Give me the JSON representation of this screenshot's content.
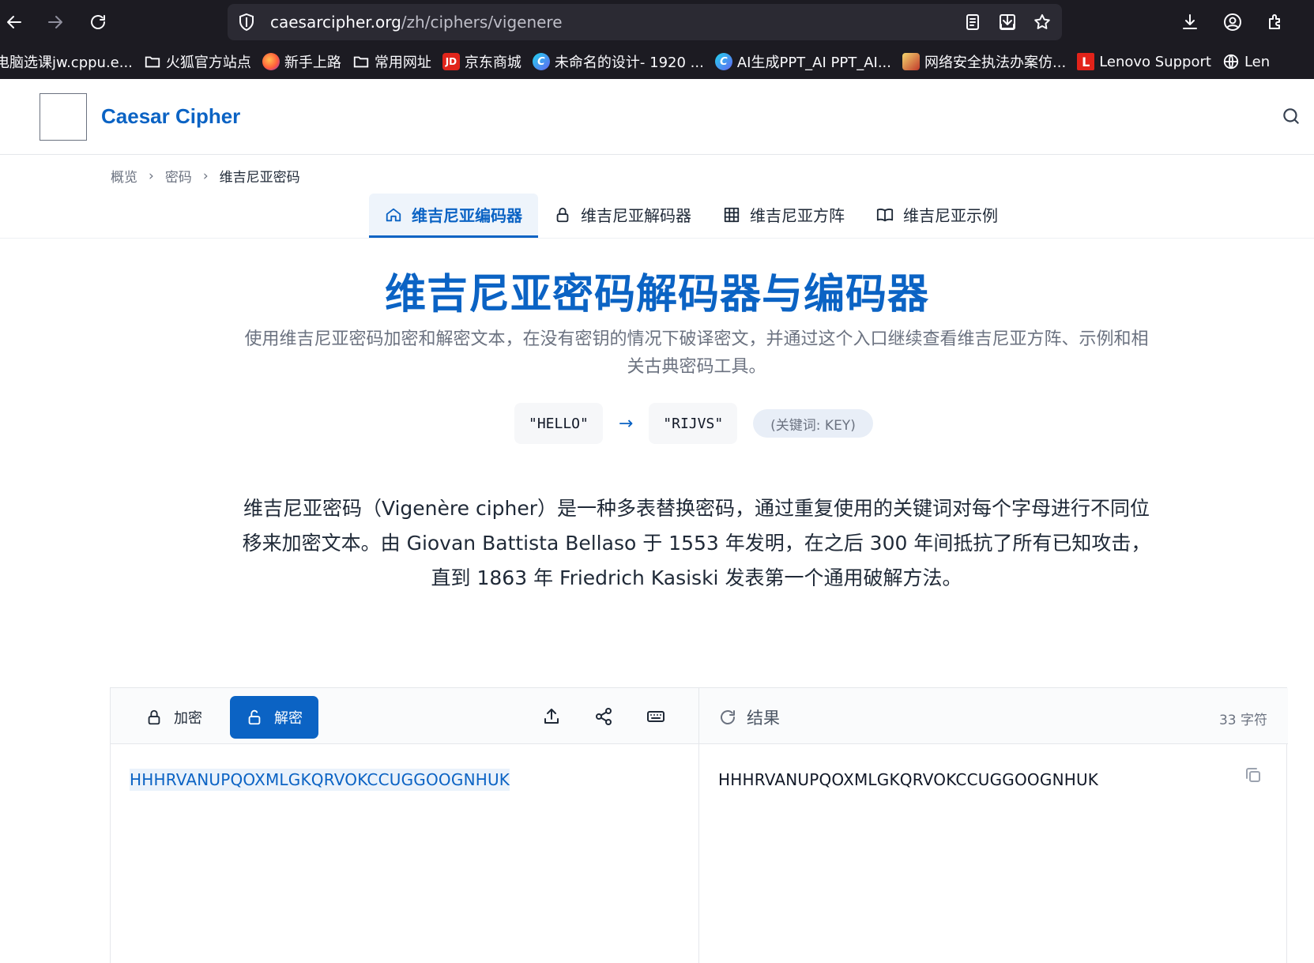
{
  "browser": {
    "url_host": "caesarcipher.org",
    "url_path": "/zh/ciphers/vigenere",
    "bookmarks": [
      {
        "label": "电脑选课jw.cppu.e...",
        "icon": "none"
      },
      {
        "label": "火狐官方站点",
        "icon": "folder-icon"
      },
      {
        "label": "新手上路",
        "icon": "firefox-icon"
      },
      {
        "label": "常用网址",
        "icon": "folder-icon"
      },
      {
        "label": "京东商城",
        "icon": "jd-icon",
        "icon_text": "JD",
        "color": "#e1251b"
      },
      {
        "label": "未命名的设计- 1920 ...",
        "icon": "canva-icon",
        "icon_text": "C",
        "color": "#3b82f6"
      },
      {
        "label": "AI生成PPT_AI PPT_AI...",
        "icon": "canva-icon",
        "icon_text": "C",
        "color": "#3b82f6"
      },
      {
        "label": "网络安全执法办案仿...",
        "icon": "image-icon",
        "icon_text": "",
        "color": "#d4a017"
      },
      {
        "label": "Lenovo Support",
        "icon": "lenovo-icon",
        "icon_text": "L",
        "color": "#e2231a"
      },
      {
        "label": "Len",
        "icon": "globe-icon"
      }
    ]
  },
  "header": {
    "brand": "Caesar Cipher"
  },
  "breadcrumb": {
    "items": [
      "概览",
      "密码",
      "维吉尼亚密码"
    ]
  },
  "tabs": [
    {
      "label": "维吉尼亚编码器",
      "icon": "home-icon",
      "active": true
    },
    {
      "label": "维吉尼亚解码器",
      "icon": "unlock-icon",
      "active": false
    },
    {
      "label": "维吉尼亚方阵",
      "icon": "grid-icon",
      "active": false
    },
    {
      "label": "维吉尼亚示例",
      "icon": "book-icon",
      "active": false
    }
  ],
  "hero": {
    "title": "维吉尼亚密码解码器与编码器",
    "subtitle": "使用维吉尼亚密码加密和解密文本，在没有密钥的情况下破译密文，并通过这个入口继续查看维吉尼亚方阵、示例和相关古典密码工具。"
  },
  "example": {
    "plain": "\"HELLO\"",
    "arrow": "→",
    "cipher": "\"RIJVS\"",
    "key_note": "(关键词: KEY)"
  },
  "description": "维吉尼亚密码（Vigenère cipher）是一种多表替换密码，通过重复使用的关键词对每个字母进行不同位移来加密文本。由 Giovan Battista Bellaso 于 1553 年发明，在之后 300 年间抵抗了所有已知攻击，直到 1863 年 Friedrich Kasiski 发表第一个通用破解方法。",
  "tool": {
    "encrypt_label": "加密",
    "decrypt_label": "解密",
    "active_mode": "decrypt",
    "input_value": "HHHRVANUPQOXMLGKQRVOKCCUGGOOGNHUK",
    "result_label": "结果",
    "char_count": "33 字符",
    "output_value": "HHHRVANUPQOXMLGKQRVOKCCUGGOOGNHUK"
  },
  "colors": {
    "accent": "#0b63c4",
    "chrome_bg": "#1c1b22",
    "urlbar_bg": "#2b2a33"
  }
}
